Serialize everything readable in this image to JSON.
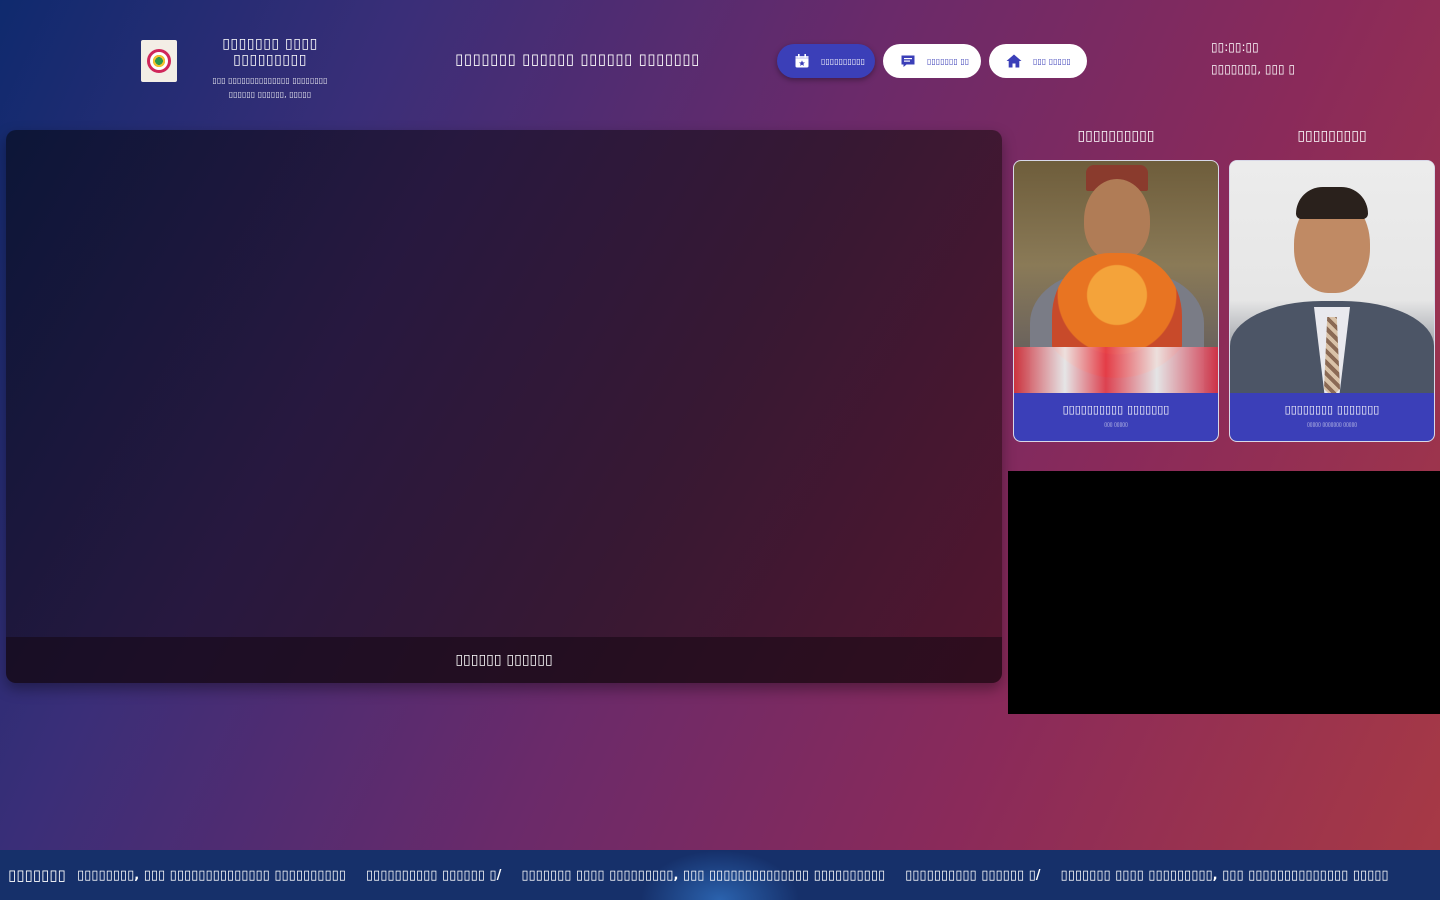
{
  "colors": {
    "accent": "#3b3fb8",
    "ticker_bg": "#16306a",
    "panel_black": "#000000"
  },
  "header": {
    "logo_icon": "municipality-logo-icon",
    "org_name": "▯▯▯▯▯▯▯ ▯▯▯▯  ▯▯▯▯▯▯▯▯▯",
    "org_sub1": "▯▯▯ ▯▯▯▯▯▯▯▯▯▯▯▯▯▯ ▯▯▯▯▯▯▯▯",
    "org_sub2": "▯▯▯▯▯▯ ▯▯▯▯▯▯, ▯▯▯▯▯",
    "title": "▯▯▯▯▯▯▯ ▯▯▯▯▯▯ ▯▯▯▯▯▯ ▯▯▯▯▯▯▯",
    "nav": [
      {
        "label": "▯▯▯▯▯▯▯▯▯▯",
        "icon": "calendar-star-icon"
      },
      {
        "label": "▯▯▯▯▯▯▯ ▯▯",
        "icon": "message-list-icon"
      },
      {
        "label": "▯▯▯ ▯▯▯▯▯",
        "icon": "home-icon"
      }
    ],
    "time": "▯▯:▯▯:▯▯",
    "date": "▯▯▯▯▯▯▯, ▯▯▯ ▯"
  },
  "video": {
    "caption": "▯▯▯▯▯▯ ▯▯▯▯▯▯"
  },
  "officials": [
    {
      "role": "▯▯▯▯▯▯▯▯▯▯",
      "name": "▯▯▯▯▯▯▯▯▯▯ ▯▯▯▯▯▯▯",
      "designation": "▯▯▯ ▯▯▯▯▯"
    },
    {
      "role": "▯▯▯▯▯▯▯▯▯",
      "name": "▯▯▯▯▯▯▯▯ ▯▯▯▯▯▯▯",
      "designation": "▯▯▯▯▯ ▯▯▯▯▯▯▯ ▯▯▯▯▯"
    }
  ],
  "ticker": {
    "label": "▯▯▯▯▯▯▯",
    "items": [
      "▯▯▯▯▯▯▯▯, ▯▯▯ ▯▯▯▯▯▯▯▯▯▯▯▯▯▯ ▯▯▯▯▯▯▯▯▯▯",
      "▯▯▯▯▯▯▯▯▯▯ ▯▯▯▯▯▯ ▯/",
      "▯▯▯▯▯▯▯ ▯▯▯▯ ▯▯▯▯▯▯▯▯▯, ▯▯▯ ▯▯▯▯▯▯▯▯▯▯▯▯▯▯ ▯▯▯▯▯▯▯▯▯▯",
      "▯▯▯▯▯▯▯▯▯▯ ▯▯▯▯▯▯ ▯/",
      "▯▯▯▯▯▯▯ ▯▯▯▯ ▯▯▯▯▯▯▯▯▯, ▯▯▯ ▯▯▯▯▯▯▯▯▯▯▯▯▯▯ ▯▯▯▯▯"
    ]
  }
}
